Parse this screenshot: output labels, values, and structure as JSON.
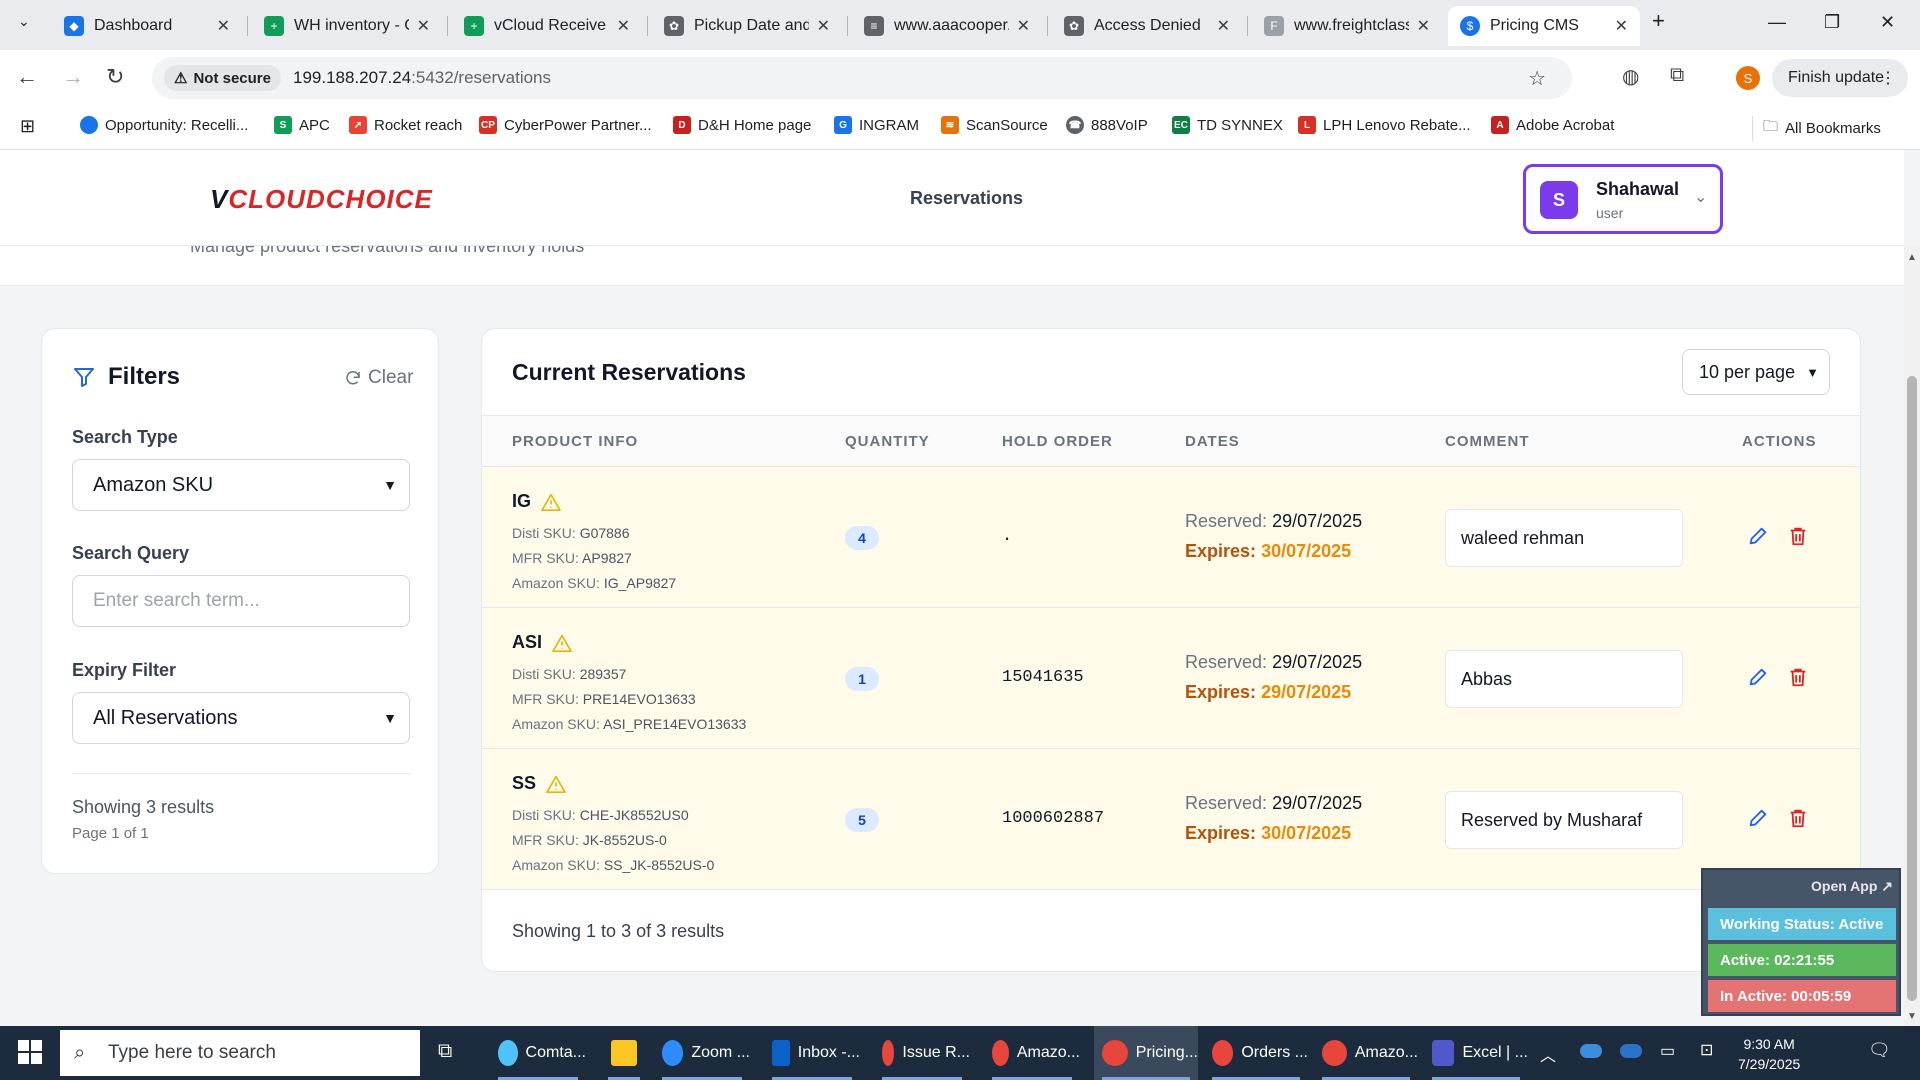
{
  "browser": {
    "tabs": [
      {
        "title": "Dashboard",
        "color": "#1a73e8"
      },
      {
        "title": "WH inventory - C",
        "color": "#0f9d58"
      },
      {
        "title": "vCloud Receive F",
        "color": "#0f9d58"
      },
      {
        "title": "Pickup Date and",
        "color": "#5f6368"
      },
      {
        "title": "www.aaacooper.",
        "color": "#5f6368"
      },
      {
        "title": "Access Denied",
        "color": "#5f6368"
      },
      {
        "title": "www.freightclass",
        "color": "#9aa0a6"
      },
      {
        "title": "Pricing CMS",
        "color": "#1a73e8"
      }
    ],
    "not_secure": "Not secure",
    "url_host": "199.188.207.24",
    "url_rest": ":5432/reservations",
    "profile_initial": "S",
    "finish_update": "Finish update",
    "bookmarks": [
      {
        "label": "Opportunity: Recelli...",
        "color": "#1a73e8"
      },
      {
        "label": "APC",
        "color": "#0f9d58"
      },
      {
        "label": "Rocket reach",
        "color": "#ea4335"
      },
      {
        "label": "CyberPower Partner...",
        "color": "#d93025"
      },
      {
        "label": "D&H Home page",
        "color": "#c5221f"
      },
      {
        "label": "INGRAM",
        "color": "#1a73e8"
      },
      {
        "label": "ScanSource",
        "color": "#e8710a"
      },
      {
        "label": "888VoIP",
        "color": "#5f6368"
      },
      {
        "label": "TD SYNNEX",
        "color": "#0b8043"
      },
      {
        "label": "LPH Lenovo Rebate...",
        "color": "#d93025"
      },
      {
        "label": "Adobe Acrobat",
        "color": "#c5221f"
      }
    ],
    "all_bookmarks": "All Bookmarks"
  },
  "app": {
    "logo_v": "V",
    "logo_text": "CLOUDCHOICE",
    "nav_title": "Reservations",
    "subtitle": "Manage product reservations and inventory holds",
    "user": {
      "initial": "S",
      "name": "Shahawal",
      "role": "user"
    }
  },
  "filters": {
    "title": "Filters",
    "clear": "Clear",
    "search_type_label": "Search Type",
    "search_type_value": "Amazon SKU",
    "search_query_label": "Search Query",
    "search_query_placeholder": "Enter search term...",
    "expiry_label": "Expiry Filter",
    "expiry_value": "All Reservations",
    "showing": "Showing 3 results",
    "page": "Page 1 of 1"
  },
  "reservations": {
    "title": "Current Reservations",
    "per_page": "10 per page",
    "columns": [
      "PRODUCT INFO",
      "QUANTITY",
      "HOLD ORDER",
      "DATES",
      "COMMENT",
      "ACTIONS"
    ],
    "sku_labels": {
      "disti": "Disti SKU:",
      "mfr": "MFR SKU:",
      "amazon": "Amazon SKU:"
    },
    "date_labels": {
      "reserved": "Reserved:",
      "expires": "Expires:"
    },
    "rows": [
      {
        "name": "IG",
        "disti": "G07886",
        "mfr": "AP9827",
        "amazon": "IG_AP9827",
        "qty": "4",
        "hold": ".",
        "reserved": "29/07/2025",
        "expires": "30/07/2025",
        "comment": "waleed rehman"
      },
      {
        "name": "ASI",
        "disti": "289357",
        "mfr": "PRE14EVO13633",
        "amazon": "ASI_PRE14EVO13633",
        "qty": "1",
        "hold": "15041635",
        "reserved": "29/07/2025",
        "expires": "29/07/2025",
        "comment": "Abbas"
      },
      {
        "name": "SS",
        "disti": "CHE-JK8552US0",
        "mfr": "JK-8552US-0",
        "amazon": "SS_JK-8552US-0",
        "qty": "5",
        "hold": "1000602887",
        "reserved": "29/07/2025",
        "expires": "30/07/2025",
        "comment": "Reserved by Musharaf"
      }
    ],
    "footer": "Showing 1 to 3 of 3 results"
  },
  "widget": {
    "open_app": "Open App ↗",
    "status": "Working Status: Active",
    "active": "Active: 02:21:55",
    "inactive": "In Active: 00:05:59",
    "colors": {
      "status": "#5bc0de",
      "active": "#5cb85c",
      "inactive": "#e57373"
    }
  },
  "taskbar": {
    "search_placeholder": "Type here to search",
    "items": [
      {
        "label": "Comta...",
        "color": "#4fc3f7"
      },
      {
        "label": "",
        "color": "#f9c623"
      },
      {
        "label": "Zoom ...",
        "color": "#2d8cff"
      },
      {
        "label": "Inbox -...",
        "color": "#0a64c8"
      },
      {
        "label": "Issue R...",
        "color": "#e8453c"
      },
      {
        "label": "Amazo...",
        "color": "#e8453c"
      },
      {
        "label": "Pricing...",
        "color": "#e8453c"
      },
      {
        "label": "Orders ...",
        "color": "#e8453c"
      },
      {
        "label": "Amazo...",
        "color": "#e8453c"
      },
      {
        "label": "Excel | ...",
        "color": "#5059c9"
      }
    ],
    "time": "9:30 AM",
    "date": "7/29/2025"
  }
}
